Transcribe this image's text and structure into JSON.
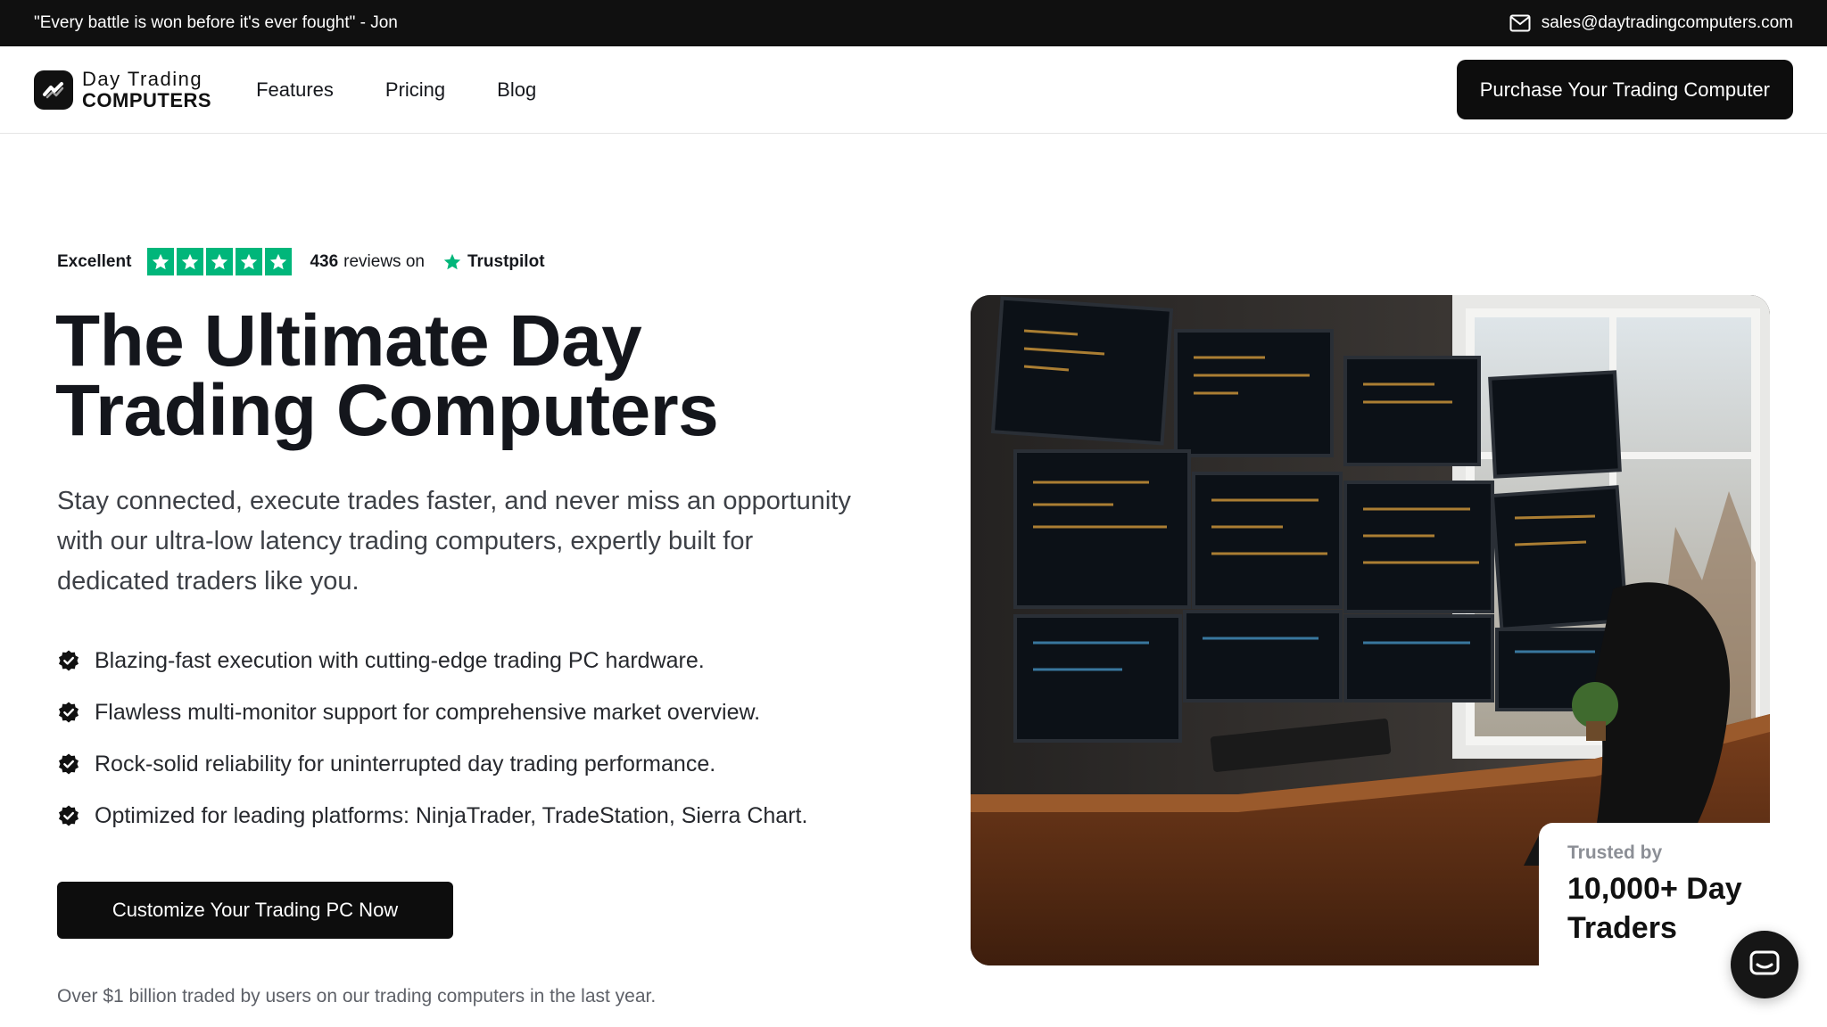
{
  "topbar": {
    "quote": "\"Every battle is won before it's ever fought\" - Jon",
    "email": "sales@daytradingcomputers.com",
    "email_icon": "mail-icon"
  },
  "nav": {
    "logo_line1": "Day Trading",
    "logo_line2": "COMPUTERS",
    "links": [
      "Features",
      "Pricing",
      "Blog"
    ],
    "cta": "Purchase Your Trading Computer"
  },
  "rating": {
    "label": "Excellent",
    "stars": 5,
    "reviews_count": "436",
    "reviews_suffix": "reviews on",
    "platform": "Trustpilot",
    "star_color": "#00b67a"
  },
  "hero": {
    "title_line1": "The Ultimate Day",
    "title_line2": "Trading Computers",
    "subtitle": "Stay connected, execute trades faster, and never miss an opportunity with our ultra-low latency trading computers, expertly built for dedicated traders like you.",
    "features": [
      "Blazing-fast execution with cutting-edge trading PC hardware.",
      "Flawless multi-monitor support for comprehensive market overview.",
      "Rock-solid reliability for uninterrupted day trading performance.",
      "Optimized for leading platforms: NinjaTrader, TradeStation, Sierra Chart."
    ],
    "cta": "Customize Your Trading PC Now",
    "footnote": "Over $1 billion traded by users on our trading computers in the last year."
  },
  "trust_card": {
    "label": "Trusted by",
    "value": "10,000+ Day Traders"
  },
  "chat": {
    "icon": "chat-icon"
  },
  "colors": {
    "brand_dark": "#0d0d0d",
    "trustpilot_green": "#00b67a"
  }
}
